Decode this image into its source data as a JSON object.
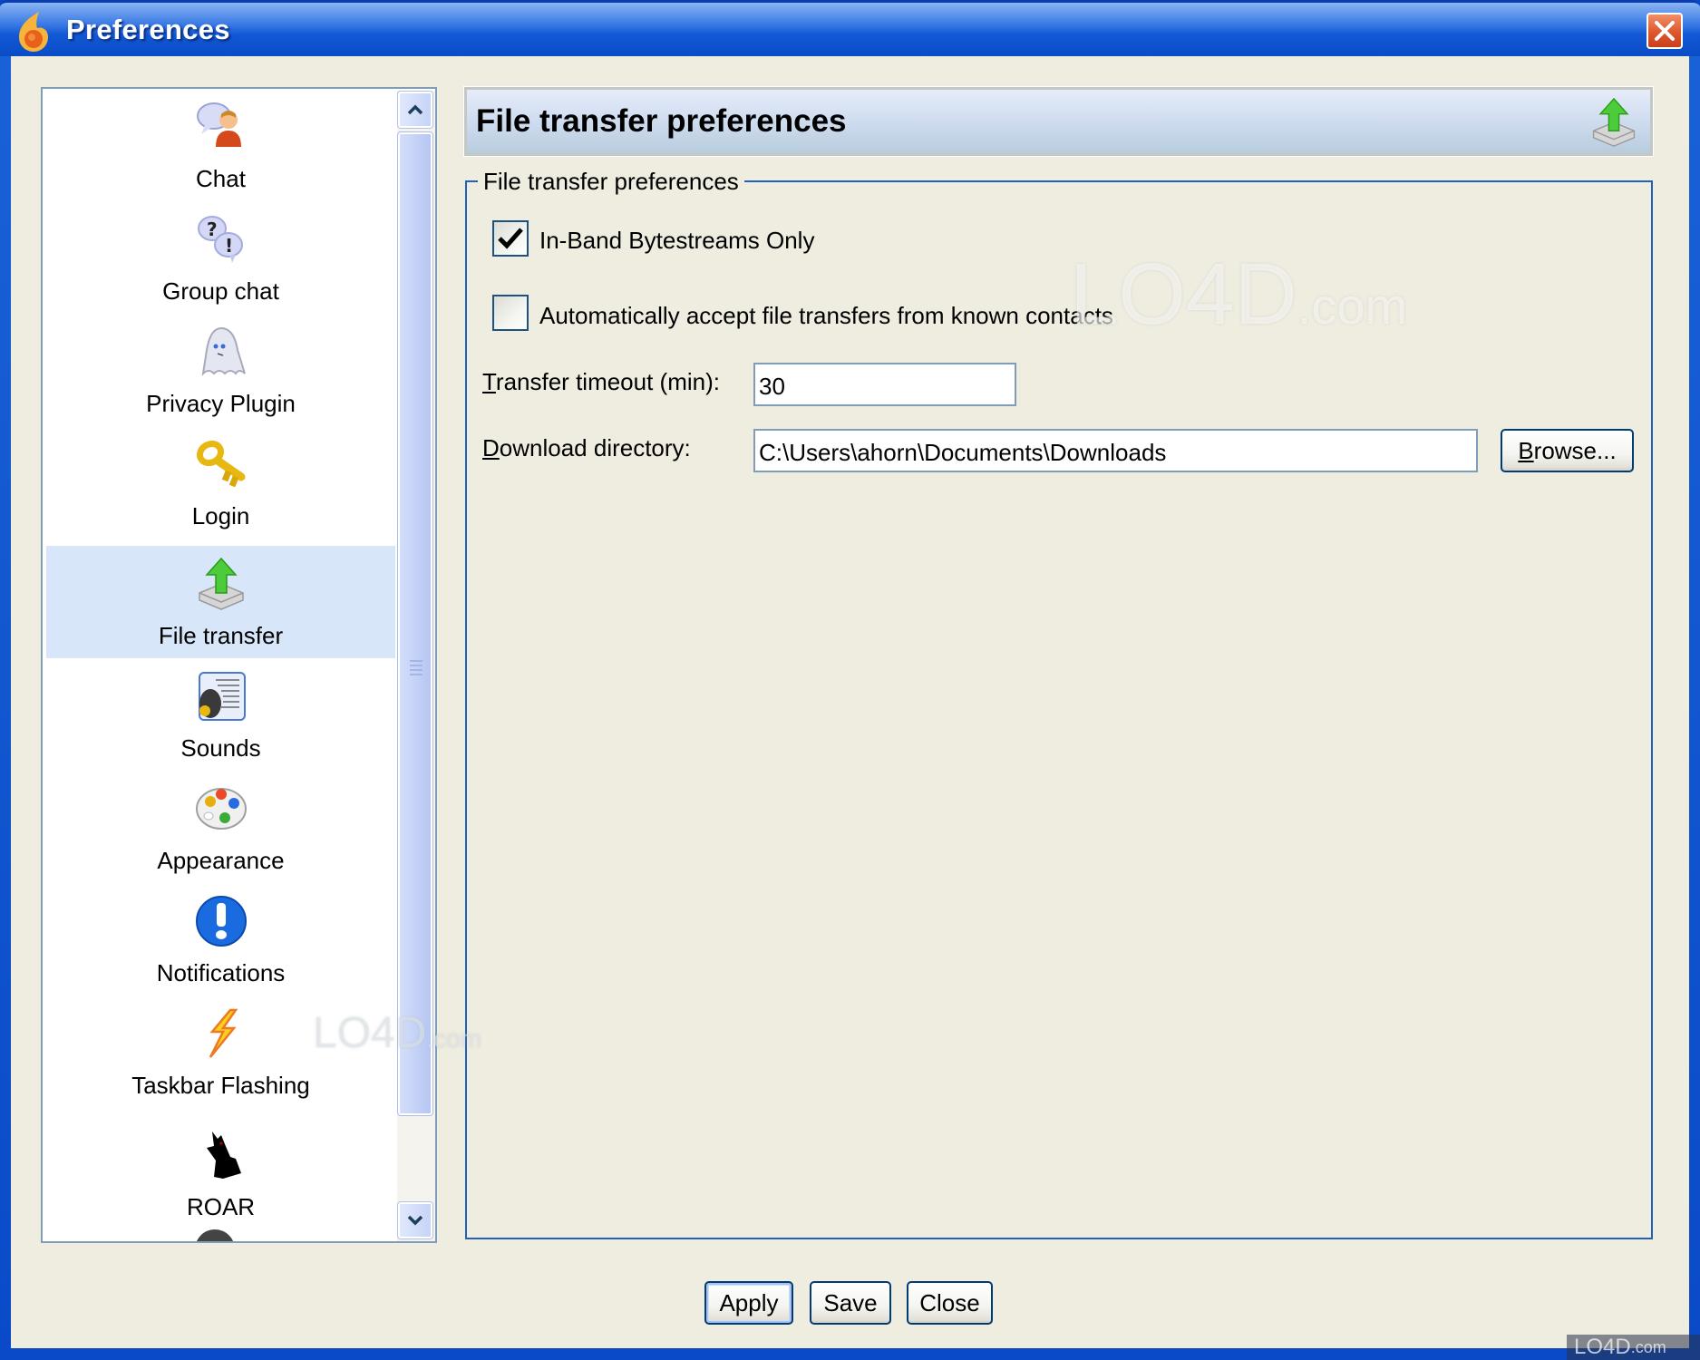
{
  "window": {
    "title": "Preferences",
    "close_label": "Close window"
  },
  "sidebar": {
    "items": [
      {
        "label": "Chat",
        "icon": "chat-user-icon"
      },
      {
        "label": "Group chat",
        "icon": "group-chat-icon"
      },
      {
        "label": "Privacy Plugin",
        "icon": "ghost-icon"
      },
      {
        "label": "Login",
        "icon": "key-icon"
      },
      {
        "label": "File transfer",
        "icon": "file-transfer-icon",
        "selected": true
      },
      {
        "label": "Sounds",
        "icon": "speaker-icon"
      },
      {
        "label": "Appearance",
        "icon": "palette-icon"
      },
      {
        "label": "Notifications",
        "icon": "exclamation-icon"
      },
      {
        "label": "Taskbar Flashing",
        "icon": "lightning-icon"
      },
      {
        "label": "ROAR",
        "icon": "wolf-icon"
      }
    ],
    "selected_index": 4
  },
  "header": {
    "title": "File transfer preferences"
  },
  "group": {
    "legend": "File transfer preferences",
    "in_band_only": {
      "label": "In-Band Bytestreams Only",
      "checked": true
    },
    "auto_accept": {
      "label": "Automatically accept file transfers from known contacts",
      "checked": false
    },
    "timeout": {
      "label_mnemonic": "T",
      "label_rest": "ransfer timeout (min):",
      "value": "30"
    },
    "download_dir": {
      "label_mnemonic": "D",
      "label_rest": "ownload directory:",
      "value": "C:\\Users\\ahorn\\Documents\\Downloads"
    },
    "browse": {
      "label_mnemonic": "B",
      "label_rest": "rowse..."
    }
  },
  "footer": {
    "apply": "Apply",
    "save": "Save",
    "close": "Close"
  },
  "watermark": {
    "text": "LO4D",
    "suffix": ".com"
  },
  "colors": {
    "titlebar": "#0a4cc6",
    "body": "#efece0",
    "groupbox_border": "#1f62b8",
    "selected_item": "#d8e6fa",
    "close_button": "#e05a30"
  }
}
